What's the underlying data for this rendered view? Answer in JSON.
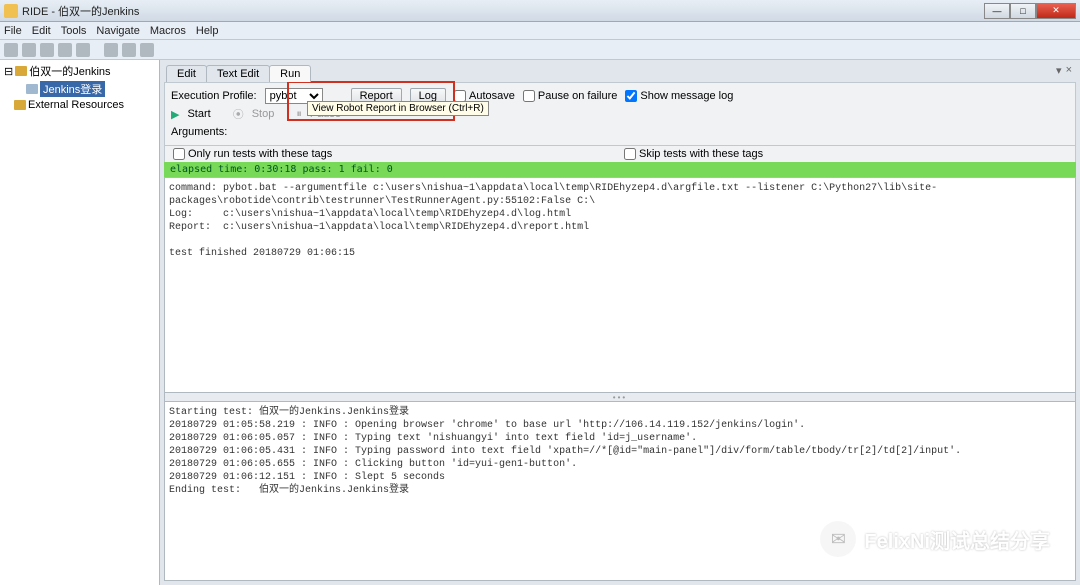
{
  "titlebar": {
    "text": "RIDE - 伯双一的Jenkins"
  },
  "menubar": [
    "File",
    "Edit",
    "Tools",
    "Navigate",
    "Macros",
    "Help"
  ],
  "tree": {
    "root": "伯双一的Jenkins",
    "selected": "Jenkins登录",
    "external": "External Resources"
  },
  "tabs": {
    "edit": "Edit",
    "textedit": "Text Edit",
    "run": "Run"
  },
  "run": {
    "profile_label": "Execution Profile:",
    "profile_value": "pybot",
    "start": "Start",
    "stop": "Stop",
    "pause_btn": "Pause",
    "report": "Report",
    "log": "Log",
    "autosave": "Autosave",
    "pause_on_fail": "Pause on failure",
    "show_msg": "Show message log",
    "tooltip": "View Robot Report in Browser (Ctrl+R)",
    "arguments": "Arguments:",
    "only_tags": "Only run tests with these tags",
    "skip_tags": "Skip tests with these tags"
  },
  "status": "elapsed time: 0:30:18   pass: 1   fail: 0",
  "output": "command: pybot.bat --argumentfile c:\\users\\nishua~1\\appdata\\local\\temp\\RIDEhyzep4.d\\argfile.txt --listener C:\\Python27\\lib\\site-packages\\robotide\\contrib\\testrunner\\TestRunnerAgent.py:55102:False C:\\\nLog:     c:\\users\\nishua~1\\appdata\\local\\temp\\RIDEhyzep4.d\\log.html\nReport:  c:\\users\\nishua~1\\appdata\\local\\temp\\RIDEhyzep4.d\\report.html\n\ntest finished 20180729 01:06:15",
  "log": "Starting test: 伯双一的Jenkins.Jenkins登录\n20180729 01:05:58.219 : INFO : Opening browser 'chrome' to base url 'http://106.14.119.152/jenkins/login'.\n20180729 01:06:05.057 : INFO : Typing text 'nishuangyi' into text field 'id=j_username'.\n20180729 01:06:05.431 : INFO : Typing password into text field 'xpath=//*[@id=\"main-panel\"]/div/form/table/tbody/tr[2]/td[2]/input'.\n20180729 01:06:05.655 : INFO : Clicking button 'id=yui-gen1-button'.\n20180729 01:06:12.151 : INFO : Slept 5 seconds\nEnding test:   伯双一的Jenkins.Jenkins登录",
  "watermark": "FelixNi测试总结分享"
}
